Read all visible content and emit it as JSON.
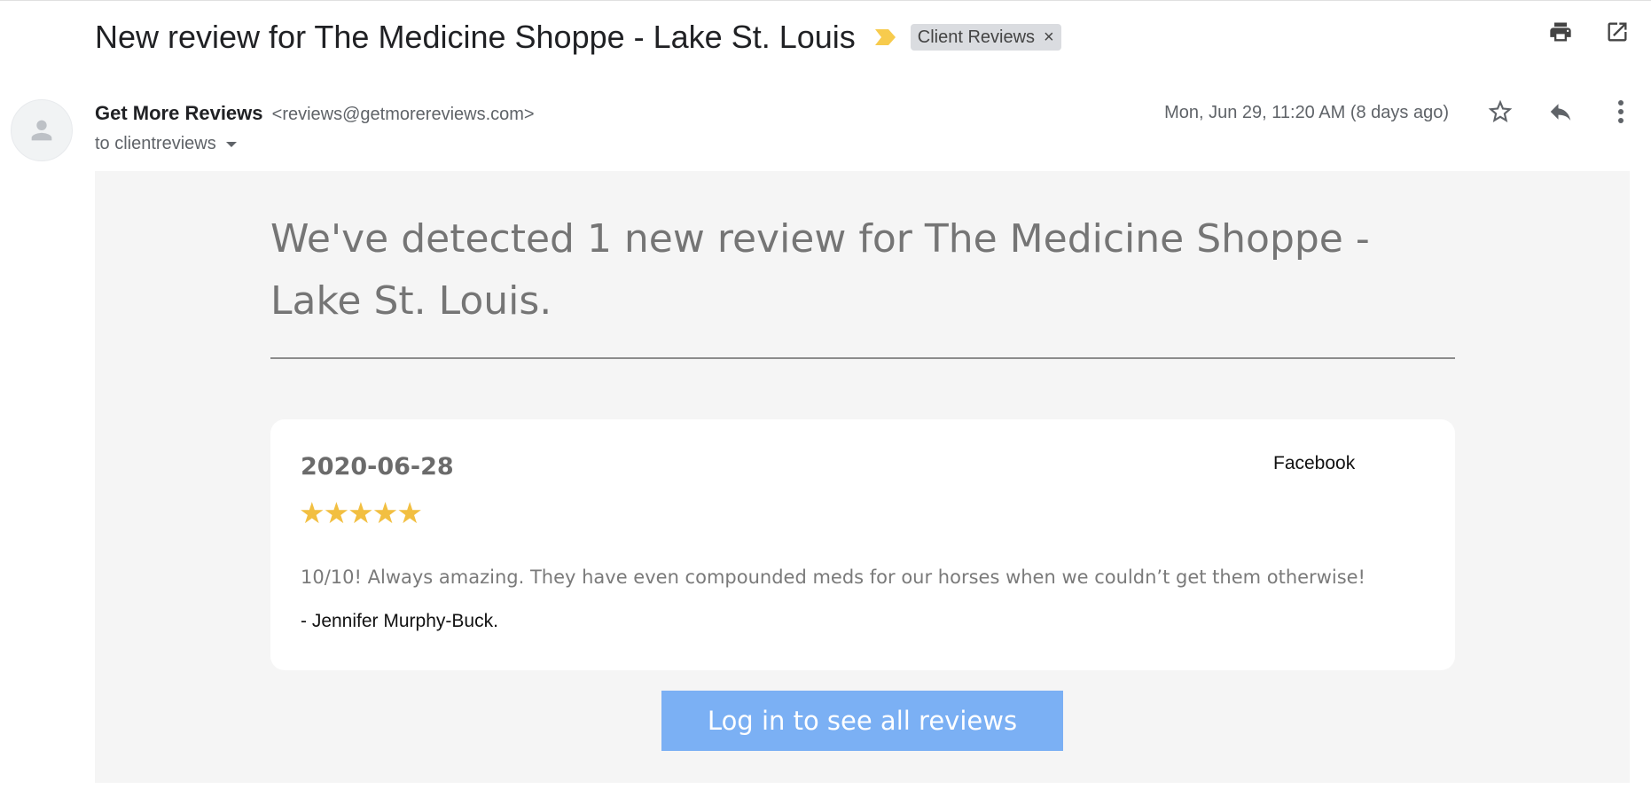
{
  "email": {
    "subject": "New review for The Medicine Shoppe - Lake St. Louis",
    "label": "Client Reviews",
    "label_remove": "×",
    "sender_name": "Get More Reviews",
    "sender_email": "<reviews@getmorereviews.com>",
    "to": "to clientreviews",
    "date": "Mon, Jun 29, 11:20 AM (8 days ago)"
  },
  "icons": {
    "important_marker": "important-marker-icon",
    "print": "print-icon",
    "open_new_window": "open-in-new-window-icon",
    "star": "star-outline-icon",
    "reply": "reply-icon",
    "more": "more-vertical-icon",
    "avatar": "default-avatar-icon",
    "to_dropdown": "caret-down-icon"
  },
  "body": {
    "headline": "We've detected 1 new review for The Medicine Shoppe - Lake St. Louis.",
    "review": {
      "date": "2020-06-28",
      "source": "Facebook",
      "rating": 5,
      "stars": "★★★★★",
      "text": "10/10! Always amazing. They have even compounded meds for our horses when we couldn’t get them otherwise!",
      "author": "- Jennifer Murphy-Buck."
    },
    "cta_label": "Log in to see all reviews"
  },
  "colors": {
    "body_background": "#f5f5f5",
    "headline_text": "#757575",
    "star_color": "#f2bf41",
    "cta_background": "#7bb0f4",
    "important_marker": "#f7cb4d"
  }
}
